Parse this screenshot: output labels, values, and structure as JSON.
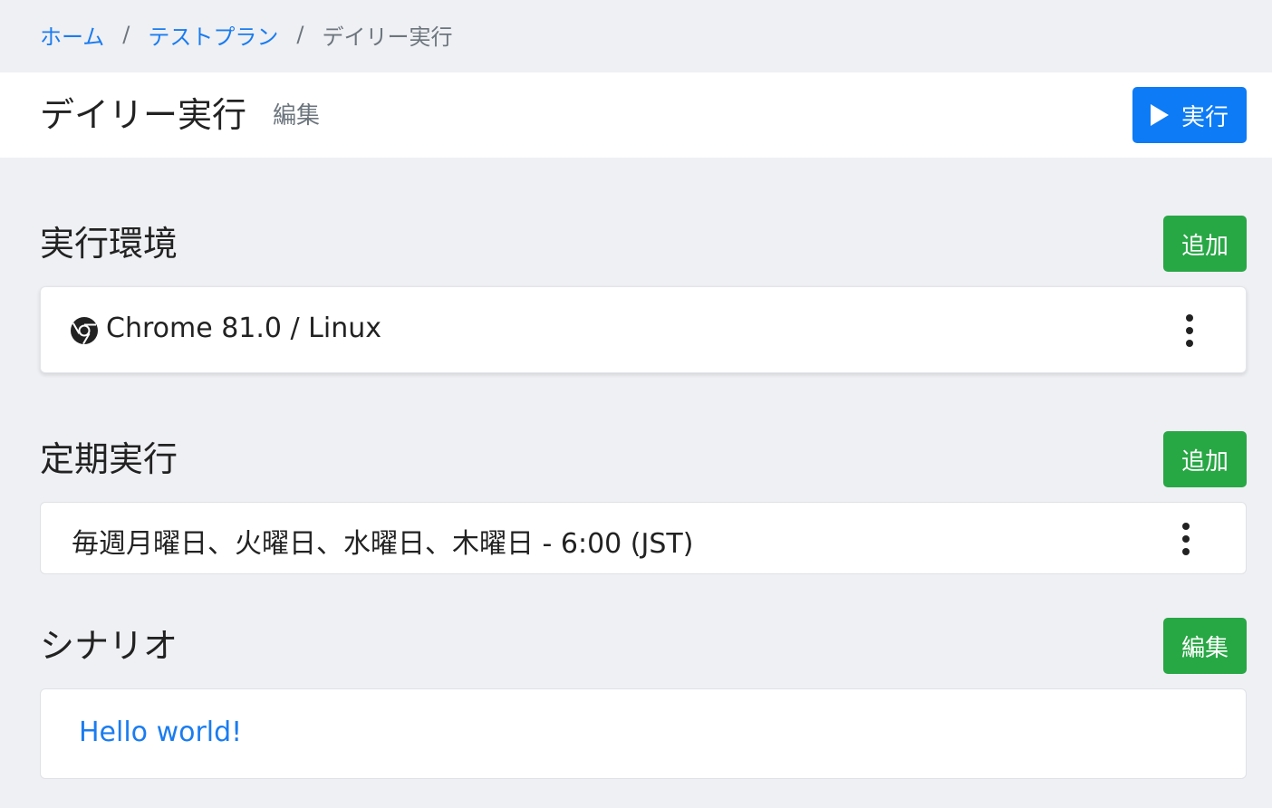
{
  "breadcrumb": {
    "items": [
      "ホーム",
      "テストプラン"
    ],
    "separator": "/",
    "current": "デイリー実行"
  },
  "header": {
    "title": "デイリー実行",
    "edit_label": "編集",
    "run_label": "実行"
  },
  "environments": {
    "title": "実行環境",
    "add_label": "追加",
    "items": [
      {
        "label": "Chrome 81.0 / Linux",
        "icon": "chrome-icon"
      }
    ]
  },
  "schedule": {
    "title": "定期実行",
    "add_label": "追加",
    "items": [
      {
        "label": "毎週月曜日、火曜日、水曜日、木曜日 - 6:00 (JST)"
      }
    ]
  },
  "scenario": {
    "title": "シナリオ",
    "edit_label": "編集",
    "items": [
      {
        "label": "Hello world!"
      }
    ]
  },
  "colors": {
    "primary": "#0d7bf5",
    "success": "#28a745",
    "link": "#1a7cf0",
    "background": "#eff0f4"
  }
}
